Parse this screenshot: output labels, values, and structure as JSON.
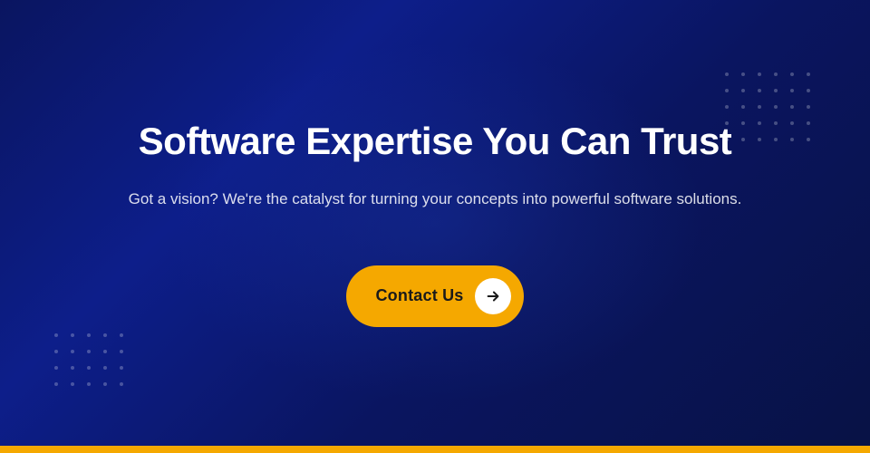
{
  "hero": {
    "title": "Software Expertise You Can Trust",
    "subtitle": "Got a vision? We're the catalyst for turning your concepts into powerful software solutions.",
    "cta_button_label": "Contact Us",
    "cta_arrow": "→"
  },
  "colors": {
    "background_start": "#0a1560",
    "background_end": "#081245",
    "accent": "#f5a800",
    "text_primary": "#ffffff",
    "text_secondary": "rgba(255,255,255,0.85)",
    "bottom_bar": "#f5a800"
  },
  "dots": {
    "top_right_cols": 6,
    "top_right_rows": 5,
    "bottom_left_cols": 5,
    "bottom_left_rows": 4
  }
}
